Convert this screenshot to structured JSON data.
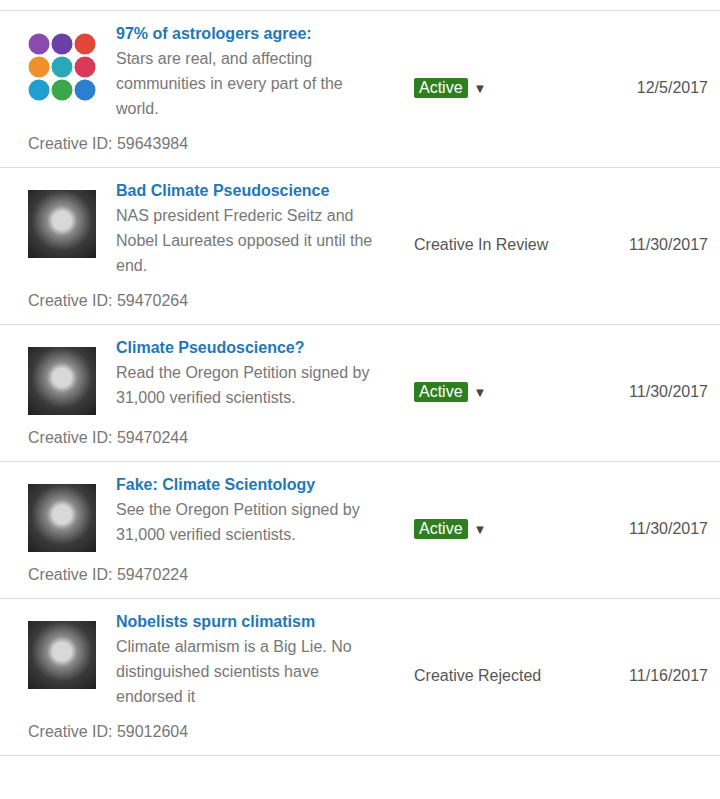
{
  "creatives": [
    {
      "thumbnail": {
        "kind": "zodiac"
      },
      "title": "97% of astrologers agree:",
      "description": "Stars are real, and affecting communities in every part of the world.",
      "creative_id": "Creative ID: 59643984",
      "status": {
        "kind": "badge",
        "label": "Active",
        "menu": "▼"
      },
      "date": "12/5/2017"
    },
    {
      "thumbnail": {
        "kind": "photo"
      },
      "title": "Bad Climate Pseudoscience",
      "description": "NAS president Frederic Seitz and Nobel Laureates opposed it until the end.",
      "creative_id": "Creative ID: 59470264",
      "status": {
        "kind": "text",
        "label": "Creative In Review",
        "menu": ""
      },
      "date": "11/30/2017"
    },
    {
      "thumbnail": {
        "kind": "photo"
      },
      "title": "Climate Pseudoscience?",
      "description": "Read the Oregon Petition signed by 31,000 verified scientists.",
      "creative_id": "Creative ID: 59470244",
      "status": {
        "kind": "badge",
        "label": "Active",
        "menu": "▼"
      },
      "date": "11/30/2017"
    },
    {
      "thumbnail": {
        "kind": "photo"
      },
      "title": "Fake: Climate Scientology",
      "description": "See the Oregon Petition signed by 31,000 verified scientists.",
      "creative_id": "Creative ID: 59470224",
      "status": {
        "kind": "badge",
        "label": "Active",
        "menu": "▼"
      },
      "date": "11/30/2017"
    },
    {
      "thumbnail": {
        "kind": "photo"
      },
      "title": "Nobelists spurn climatism",
      "description": "Climate alarmism is a Big Lie. No distinguished scientists have endorsed it",
      "creative_id": "Creative ID: 59012604",
      "status": {
        "kind": "text",
        "label": "Creative Rejected",
        "menu": ""
      },
      "date": "11/16/2017"
    }
  ]
}
